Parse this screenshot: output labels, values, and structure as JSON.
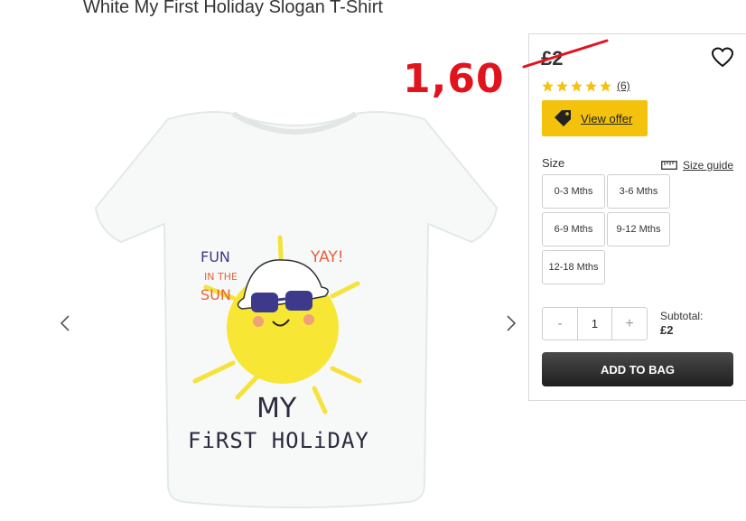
{
  "product": {
    "title": "White My First Holiday Slogan T-Shirt",
    "price": "£2",
    "new_price": "1,60",
    "rating": 5,
    "review_count": "(6)",
    "shirt_print": {
      "line1": "FUN",
      "line2": "IN THE",
      "line3": "SUN",
      "yay": "YAY!",
      "my": "MY",
      "holiday": "FiRST HOLiDAY"
    }
  },
  "offer": {
    "label": "View offer"
  },
  "size": {
    "label": "Size",
    "guide_label": "Size guide",
    "options": [
      "0-3 Mths",
      "3-6 Mths",
      "6-9 Mths",
      "9-12 Mths",
      "12-18 Mths"
    ]
  },
  "quantity": {
    "minus": "-",
    "value": "1",
    "plus": "+"
  },
  "subtotal": {
    "label": "Subtotal:",
    "value": "£2"
  },
  "cart": {
    "add_label": "ADD TO BAG"
  },
  "icons": {
    "prev": "chevron-left-icon",
    "next": "chevron-right-icon",
    "wishlist": "heart-icon",
    "star": "star-icon",
    "offer": "tag-icon",
    "size_guide": "ruler-icon"
  },
  "colors": {
    "offer_button": "#f4c20d",
    "star": "#f4c20d",
    "annotation_red": "#e1141e",
    "add_button": "#2b2b2b"
  }
}
